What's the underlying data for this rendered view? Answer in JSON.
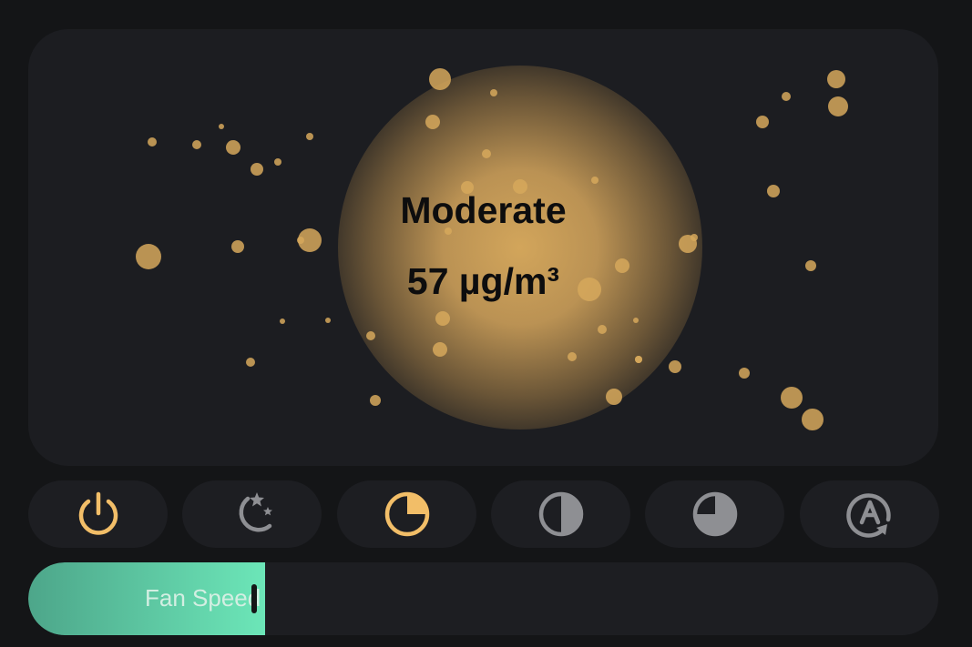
{
  "air_quality": {
    "status": "Moderate",
    "reading": "57 µg/m³",
    "glow_color": "#d6a85c",
    "particle_color": "#d6a85c"
  },
  "modes": [
    {
      "name": "power",
      "icon": "power-icon",
      "active": true
    },
    {
      "name": "sleep",
      "icon": "moon-stars-icon",
      "active": false
    },
    {
      "name": "low",
      "icon": "quarter-circle-icon",
      "active": true
    },
    {
      "name": "medium",
      "icon": "half-circle-icon",
      "active": false
    },
    {
      "name": "high",
      "icon": "three-quarter-circle-icon",
      "active": false
    },
    {
      "name": "auto",
      "icon": "auto-mode-icon",
      "active": false
    }
  ],
  "colors": {
    "active_icon": "#f2be68",
    "inactive_icon": "#8e8f93",
    "fan_fill_start": "#4da68a",
    "fan_fill_end": "#6ce6b8"
  },
  "fan": {
    "label": "Fan Speed",
    "level_percent": 26
  }
}
